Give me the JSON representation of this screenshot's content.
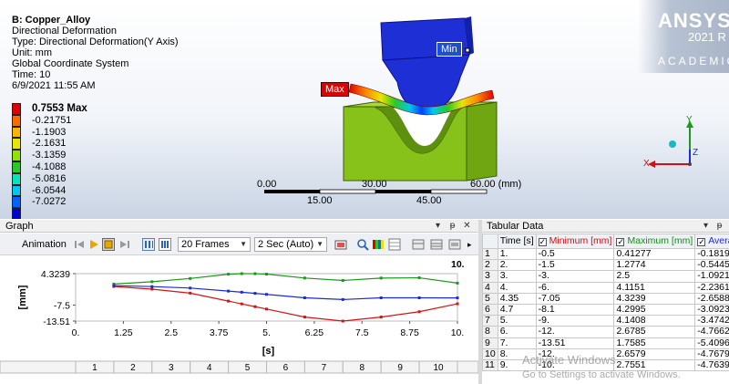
{
  "result": {
    "title": "B: Copper_Alloy",
    "lines": [
      "Directional Deformation",
      "Type: Directional Deformation(Y Axis)",
      "Unit: mm",
      "Global Coordinate System",
      "Time: 10",
      "6/9/2021 11:55 AM"
    ]
  },
  "legend": {
    "entries": [
      {
        "label": "0.7553 Max",
        "color": "#e10000"
      },
      {
        "label": "-0.21751",
        "color": "#ff6a00"
      },
      {
        "label": "-1.1903",
        "color": "#ffb300"
      },
      {
        "label": "-2.1631",
        "color": "#e6e600"
      },
      {
        "label": "-3.1359",
        "color": "#8ee600"
      },
      {
        "label": "-4.1088",
        "color": "#28c828"
      },
      {
        "label": "-5.0816",
        "color": "#00e6b4"
      },
      {
        "label": "-6.0544",
        "color": "#00c8f0"
      },
      {
        "label": "-7.0272",
        "color": "#0064ff"
      },
      {
        "label": "",
        "color": "#0000d0"
      }
    ]
  },
  "brand": {
    "name": "ANSYS",
    "version": "2021 R",
    "edition": "ACADEMIC"
  },
  "probes": {
    "min": "Min",
    "max": "Max"
  },
  "scale_bar": {
    "top": [
      "0.00",
      "30.00",
      "60.00 (mm)"
    ],
    "bottom": [
      "15.00",
      "45.00"
    ]
  },
  "axes_triad": {
    "x": "X",
    "y": "Y",
    "z": "Z"
  },
  "graph": {
    "panel_title": "Graph",
    "animation_label": "Animation",
    "frames": "20 Frames",
    "duration": "2 Sec (Auto)",
    "frame_numbers": [
      "1",
      "2",
      "3",
      "4",
      "5",
      "6",
      "7",
      "8",
      "9",
      "10"
    ]
  },
  "tabular": {
    "panel_title": "Tabular Data",
    "columns": [
      "Time [s]",
      "Minimum [mm]",
      "Maximum [mm]",
      "Avera"
    ],
    "rows": [
      [
        "1",
        "1.",
        "-0.5",
        "0.41277",
        "-0.18195"
      ],
      [
        "2",
        "2.",
        "-1.5",
        "1.2774",
        "-0.54458"
      ],
      [
        "3",
        "3.",
        "-3.",
        "2.5",
        "-1.0921"
      ],
      [
        "4",
        "4.",
        "-6.",
        "4.1151",
        "-2.2361"
      ],
      [
        "5",
        "4.35",
        "-7.05",
        "4.3239",
        "-2.6588"
      ],
      [
        "6",
        "4.7",
        "-8.1",
        "4.2995",
        "-3.0923"
      ],
      [
        "7",
        "5.",
        "-9.",
        "4.1408",
        "-3.4742"
      ],
      [
        "8",
        "6.",
        "-12.",
        "2.6785",
        "-4.7662"
      ],
      [
        "9",
        "7.",
        "-13.51",
        "1.7585",
        "-5.4096"
      ],
      [
        "10",
        "8.",
        "-12.",
        "2.6579",
        "-4.7679"
      ],
      [
        "11",
        "9.",
        "-10.",
        "2.7551",
        "-4.7639"
      ]
    ]
  },
  "watermark": {
    "line1": "Activate Windows",
    "line2": "Go to Settings to activate Windows."
  },
  "chart_data": {
    "type": "line",
    "xlabel": "[s]",
    "ylabel": "[mm]",
    "x_ticks": [
      "0.",
      "1.25",
      "2.5",
      "3.75",
      "5.",
      "6.25",
      "7.5",
      "8.75",
      "10."
    ],
    "y_ticks": [
      "4.3239",
      "-7.5",
      "-13.51"
    ],
    "xlim": [
      0,
      10
    ],
    "ylim": [
      -13.51,
      4.3239
    ],
    "x": [
      1,
      2,
      3,
      4,
      4.35,
      4.7,
      5,
      6,
      7,
      8,
      9,
      10
    ],
    "series": [
      {
        "name": "Maximum [mm]",
        "color": "#1a9a1a",
        "values": [
          0.41277,
          1.2774,
          2.5,
          4.1151,
          4.3239,
          4.2995,
          4.1408,
          2.6785,
          1.7585,
          2.6579,
          2.7551,
          0.7553
        ]
      },
      {
        "name": "Minimum [mm]",
        "color": "#d21414",
        "values": [
          -0.5,
          -1.5,
          -3.0,
          -6.0,
          -7.05,
          -8.1,
          -9.0,
          -12.0,
          -13.51,
          -12.0,
          -10.0,
          -7.0272
        ]
      },
      {
        "name": "Average [mm]",
        "color": "#1c2bd6",
        "values": [
          -0.18195,
          -0.54458,
          -1.0921,
          -2.2361,
          -2.6588,
          -3.0923,
          -3.4742,
          -4.7662,
          -5.4096,
          -4.7679,
          -4.7639,
          -4.8
        ]
      }
    ]
  }
}
